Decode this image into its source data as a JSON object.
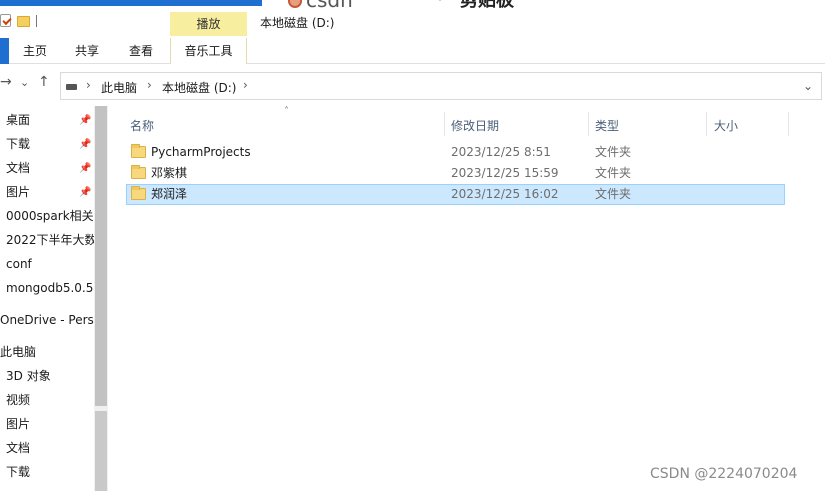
{
  "window": {
    "title": "本地磁盘 (D:)",
    "context_tab_group": "播放"
  },
  "overlay": {
    "csdn_top_text": "csdn",
    "top_right_text": "剪贴板"
  },
  "ribbon": {
    "tabs": [
      "主页",
      "共享",
      "查看",
      "音乐工具"
    ]
  },
  "address": {
    "breadcrumbs": [
      "此电脑",
      "本地磁盘 (D:)"
    ]
  },
  "sidebar": {
    "items": [
      {
        "label": "桌面",
        "pinned": true
      },
      {
        "label": "下载",
        "pinned": true
      },
      {
        "label": "文档",
        "pinned": true
      },
      {
        "label": "图片",
        "pinned": true
      },
      {
        "label": "0000spark相关",
        "pinned": false
      },
      {
        "label": "2022下半年大数",
        "pinned": false
      },
      {
        "label": "conf",
        "pinned": false
      },
      {
        "label": "mongodb5.0.5",
        "pinned": false
      },
      {
        "label": "OneDrive - Perso",
        "pinned": false
      },
      {
        "label": "此电脑",
        "pinned": false
      },
      {
        "label": "3D 对象",
        "pinned": false
      },
      {
        "label": "视频",
        "pinned": false
      },
      {
        "label": "图片",
        "pinned": false
      },
      {
        "label": "文档",
        "pinned": false
      },
      {
        "label": "下载",
        "pinned": false
      }
    ]
  },
  "columns": {
    "name": "名称",
    "date": "修改日期",
    "type": "类型",
    "size": "大小"
  },
  "files": [
    {
      "name": "PycharmProjects",
      "date": "2023/12/25 8:51",
      "type": "文件夹",
      "selected": false
    },
    {
      "name": "邓紫棋",
      "date": "2023/12/25 15:59",
      "type": "文件夹",
      "selected": false
    },
    {
      "name": "郑润泽",
      "date": "2023/12/25 16:02",
      "type": "文件夹",
      "selected": true
    }
  ],
  "watermark": "CSDN @2224070204",
  "colors": {
    "accent": "#1e6fd0",
    "context_tab": "#f8eea0",
    "selection": "#cce8ff",
    "header_text": "#4c607a"
  }
}
